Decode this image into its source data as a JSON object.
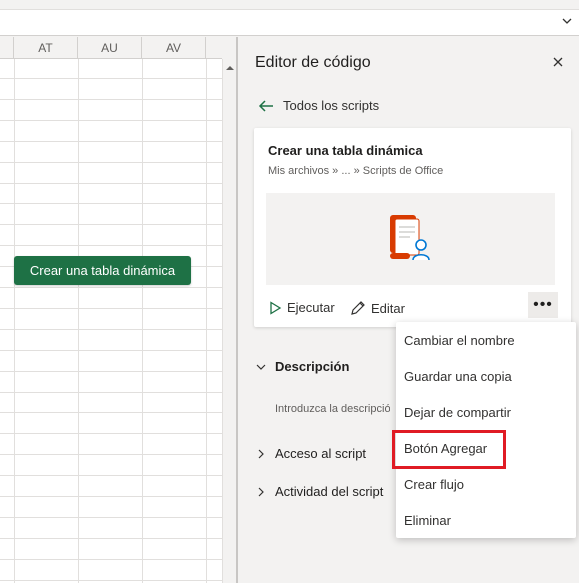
{
  "colors": {
    "accent": "#1e7145",
    "highlight_box": "#e01b24"
  },
  "spreadsheet": {
    "column_headers": [
      "AT",
      "AU",
      "AV"
    ],
    "sheet_button_label": "Crear una tabla dinámica"
  },
  "pane": {
    "title": "Editor de código",
    "back_label": "Todos los scripts",
    "card": {
      "title": "Crear una tabla dinámica",
      "path": "Mis archivos » ... » Scripts de Office",
      "run_label": "Ejecutar",
      "edit_label": "Editar",
      "more_label": "•••"
    },
    "description_label": "Descripción",
    "description_placeholder": "Introduzca la descripción",
    "access_label": "Acceso al script",
    "activity_label": "Actividad del script"
  },
  "menu": {
    "items": [
      "Cambiar el nombre",
      "Guardar una copia",
      "Dejar de compartir",
      "Botón Agregar",
      "Crear flujo",
      "Eliminar"
    ],
    "highlighted_index": 3
  }
}
